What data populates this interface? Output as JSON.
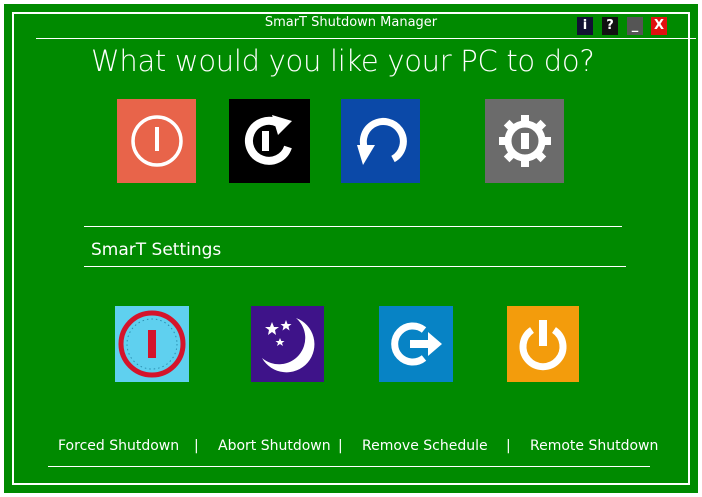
{
  "window": {
    "title": "SmarT Shutdown Manager",
    "controls": {
      "info": "i",
      "help": "?",
      "minimize": "_",
      "close": "X"
    }
  },
  "main": {
    "heading": "What would you like your PC to do?",
    "actions": [
      {
        "name": "shutdown",
        "icon": "power-icon",
        "color": "#e8644a"
      },
      {
        "name": "restart",
        "icon": "restart-icon",
        "color": "#000000"
      },
      {
        "name": "refresh",
        "icon": "refresh-icon",
        "color": "#0b49a8"
      },
      {
        "name": "settings",
        "icon": "gear-icon",
        "color": "#6b6b6b"
      }
    ]
  },
  "smart_settings": {
    "title": "SmarT Settings",
    "items": [
      {
        "name": "timer",
        "icon": "timer-icon",
        "color": "#5fd0ef"
      },
      {
        "name": "sleep",
        "icon": "moon-stars-icon",
        "color": "#3e1389"
      },
      {
        "name": "logoff",
        "icon": "logoff-icon",
        "color": "#0783c5"
      },
      {
        "name": "standby",
        "icon": "standby-icon",
        "color": "#f39c0c"
      }
    ]
  },
  "footer": {
    "links": [
      "Forced Shutdown",
      "Abort Shutdown",
      "Remove Schedule",
      "Remote Shutdown"
    ],
    "separator": "|"
  },
  "colors": {
    "background": "#008a00",
    "text": "#ffffff"
  }
}
